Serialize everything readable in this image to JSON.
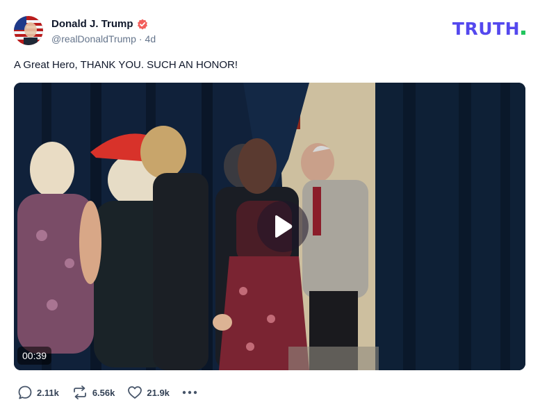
{
  "author": {
    "display_name": "Donald J. Trump",
    "handle": "@realDonaldTrump",
    "separator": "·",
    "time_ago": "4d",
    "verified_icon": "verified-badge-icon"
  },
  "brand": {
    "logo_text": "TRUTH",
    "logo_color": "#5448ee",
    "logo_dot_color": "#22c55e"
  },
  "post": {
    "text": "A Great Hero, THANK YOU. SUCH AN HONOR!"
  },
  "video": {
    "duration": "00:39",
    "play_icon": "play-icon"
  },
  "actions": {
    "replies": {
      "icon": "reply-icon",
      "count": "2.11k"
    },
    "retruths": {
      "icon": "retruth-icon",
      "count": "6.56k"
    },
    "likes": {
      "icon": "heart-icon",
      "count": "21.9k"
    },
    "more": {
      "icon": "more-dots-icon"
    }
  }
}
